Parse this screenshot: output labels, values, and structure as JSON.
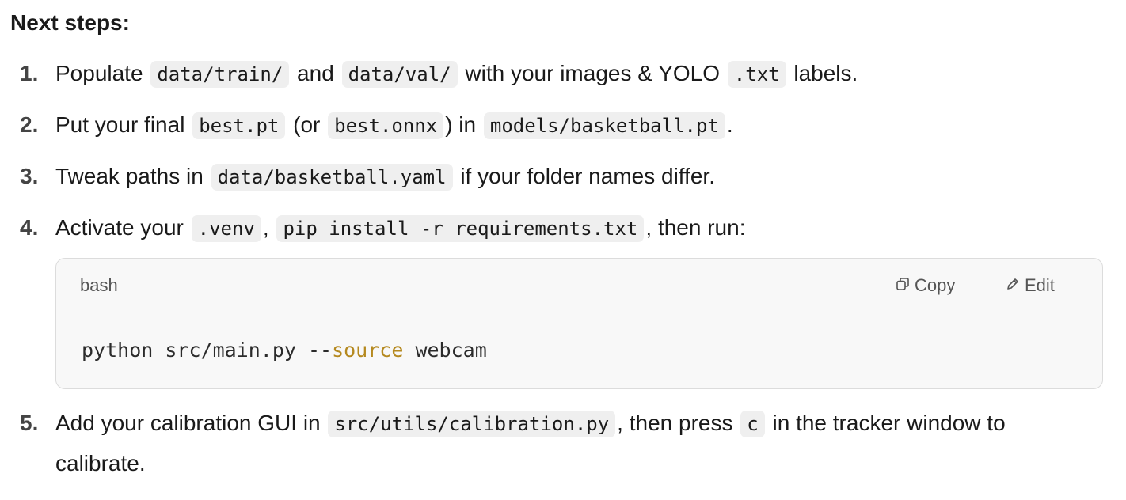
{
  "heading": "Next steps:",
  "steps": [
    {
      "num": "1.",
      "parts": [
        "Populate ",
        "data/train/",
        " and ",
        "data/val/",
        " with your images & YOLO ",
        ".txt",
        " labels."
      ]
    },
    {
      "num": "2.",
      "parts": [
        "Put your final ",
        "best.pt",
        " (or ",
        "best.onnx",
        ") in ",
        "models/basketball.pt",
        "."
      ]
    },
    {
      "num": "3.",
      "parts": [
        "Tweak paths in ",
        "data/basketball.yaml",
        " if your folder names differ."
      ]
    },
    {
      "num": "4.",
      "parts": [
        "Activate your ",
        ".venv",
        ", ",
        "pip install -r requirements.txt",
        ", then run:"
      ]
    },
    {
      "num": "5.",
      "parts": [
        "Add your calibration GUI in ",
        "src/utils/calibration.py",
        ", then press ",
        "c",
        " in the tracker window to calibrate."
      ]
    }
  ],
  "codeblock": {
    "language": "bash",
    "copy_label": "Copy",
    "edit_label": "Edit",
    "code_before": "python src/main.py --",
    "code_keyword": "source",
    "code_after": " webcam",
    "keyword_color": "#b5891f",
    "copy_icon": "copy-icon",
    "edit_icon": "edit-pencil-icon"
  }
}
